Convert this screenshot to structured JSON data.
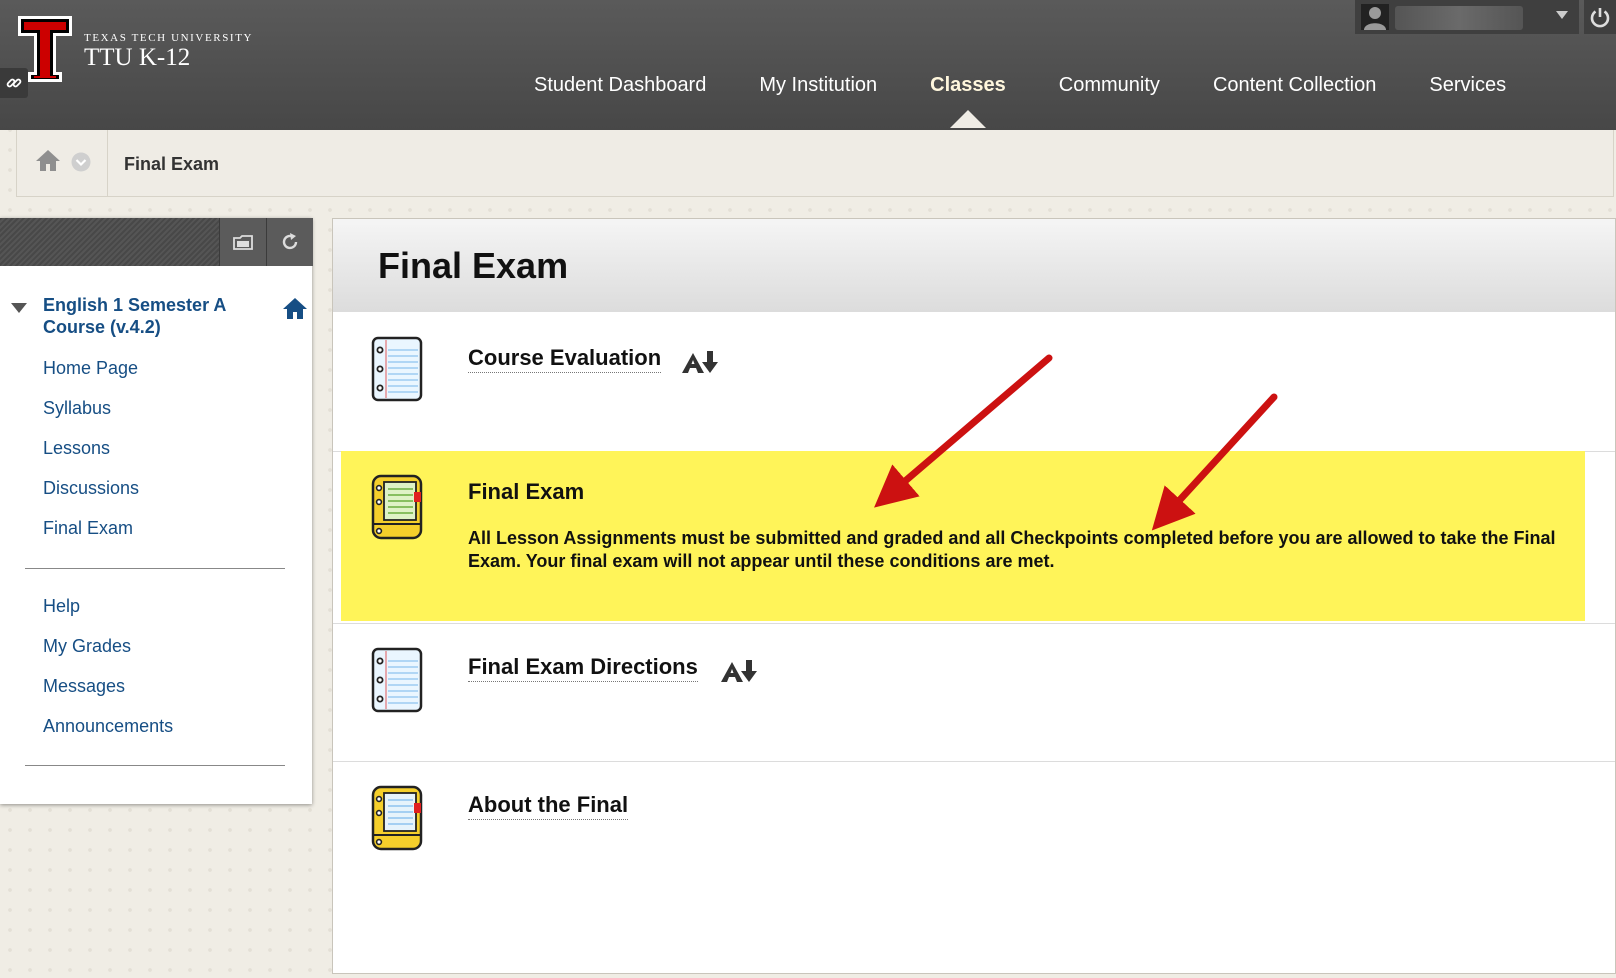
{
  "header": {
    "university_small": "TEXAS TECH UNIVERSITY",
    "university_big": "TTU K-12",
    "nav": [
      {
        "label": "Student Dashboard",
        "active": false
      },
      {
        "label": "My Institution",
        "active": false
      },
      {
        "label": "Classes",
        "active": true
      },
      {
        "label": "Community",
        "active": false
      },
      {
        "label": "Content Collection",
        "active": false
      },
      {
        "label": "Services",
        "active": false
      }
    ]
  },
  "breadcrumb": {
    "current": "Final Exam"
  },
  "sidebar": {
    "course_title": "English 1 Semester A Course (v.4.2)",
    "menu_primary": [
      "Home Page",
      "Syllabus",
      "Lessons",
      "Discussions",
      "Final Exam"
    ],
    "menu_secondary": [
      "Help",
      "My Grades",
      "Messages",
      "Announcements"
    ]
  },
  "content": {
    "title": "Final Exam",
    "items": [
      {
        "title": "Course Evaluation",
        "icon": "notebook-icon",
        "badge": "adaptive-release-icon"
      },
      {
        "title": "Final Exam",
        "icon": "test-icon",
        "highlighted": true,
        "description": "All Lesson Assignments must be submitted and graded and all Checkpoints completed before you are allowed to take the Final Exam.  Your final exam will not appear until these conditions are met."
      },
      {
        "title": "Final Exam Directions",
        "icon": "notebook-icon",
        "badge": "adaptive-release-icon"
      },
      {
        "title": "About the Final",
        "icon": "test-icon"
      }
    ]
  },
  "colors": {
    "nav_bg": "#4e4e4e",
    "link": "#164e84",
    "highlight": "#fff459",
    "arrow": "#cc1111",
    "brand_red": "#cc0000"
  }
}
